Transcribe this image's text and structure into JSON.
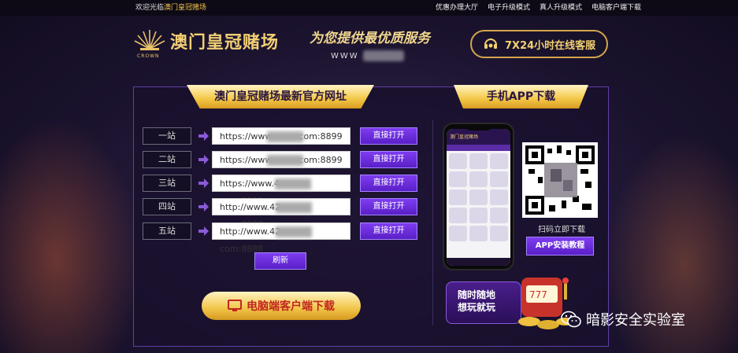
{
  "topbar": {
    "welcome_prefix": "欢迎光临",
    "welcome_brand": "澳门皇冠赌场",
    "links": [
      "优惠办理大厅",
      "电子升级模式",
      "真人升级模式",
      "电脑客户端下载"
    ]
  },
  "header": {
    "crown_word": "CROWN",
    "logo_text": "澳门皇冠赌场",
    "slogan": "为您提供最优质服务",
    "slogan_sub_prefix": "WWW",
    "service_label": "7X24小时在线客服"
  },
  "urls": {
    "title": "澳门皇冠赌场最新官方网址",
    "rows": [
      {
        "label": "一站",
        "url_start": "https://www",
        "url_end": "com:8899",
        "button": "直接打开"
      },
      {
        "label": "二站",
        "url_start": "https://www",
        "url_end": "com:8899",
        "button": "直接打开"
      },
      {
        "label": "三站",
        "url_start": "https://www.4",
        "url_end": "com:8899",
        "button": "直接打开"
      },
      {
        "label": "四站",
        "url_start": "http://www.42",
        "url_end": "com:8888",
        "button": "直接打开"
      },
      {
        "label": "五站",
        "url_start": "http://www.42",
        "url_end": "com:8888",
        "button": "直接打开"
      }
    ],
    "refresh": "刷新",
    "pc_download": "电脑端客户端下载"
  },
  "app": {
    "title": "手机APP下载",
    "phone_header": "澳门皇冠赌场",
    "scan_text": "扫码立即下载",
    "tutorial_button": "APP安装教程",
    "promo_line1": "随时随地",
    "promo_line2": "想玩就玩"
  },
  "watermark": "暗影安全实验室",
  "colors": {
    "gold": "#f2cf75",
    "purple_button": "#6a2ee0",
    "panel_border": "#5e3fa5",
    "background": "#1c1430"
  }
}
